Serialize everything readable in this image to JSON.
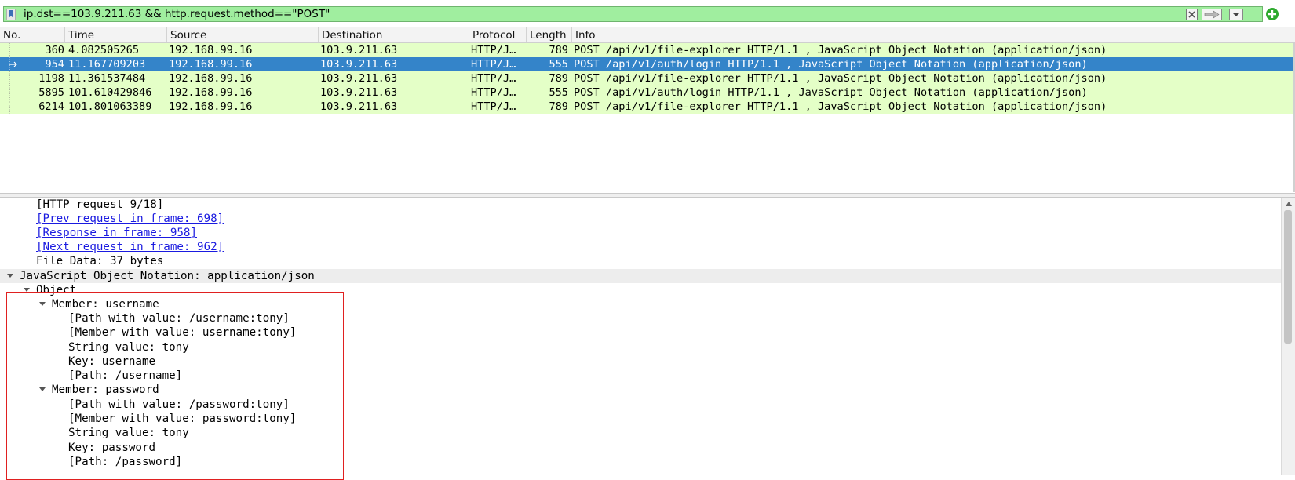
{
  "filter": {
    "expression": "ip.dst==103.9.211.63 && http.request.method==\"POST\"",
    "icons": [
      "bookmark-icon",
      "clear-icon",
      "apply-arrow-icon",
      "dropdown-icon",
      "add-icon"
    ],
    "bar_color": "#a0ee9f"
  },
  "columns": {
    "no": "No.",
    "time": "Time",
    "source": "Source",
    "destination": "Destination",
    "protocol": "Protocol",
    "length": "Length",
    "info": "Info"
  },
  "packets": [
    {
      "no": "360",
      "time": "4.082505265",
      "source": "192.168.99.16",
      "destination": "103.9.211.63",
      "protocol": "HTTP/J…",
      "length": "789",
      "info": "POST /api/v1/file-explorer HTTP/1.1 , JavaScript Object Notation (application/json)"
    },
    {
      "no": "954",
      "time": "11.167709203",
      "source": "192.168.99.16",
      "destination": "103.9.211.63",
      "protocol": "HTTP/J…",
      "length": "555",
      "info": "POST /api/v1/auth/login HTTP/1.1 , JavaScript Object Notation (application/json)"
    },
    {
      "no": "1198",
      "time": "11.361537484",
      "source": "192.168.99.16",
      "destination": "103.9.211.63",
      "protocol": "HTTP/J…",
      "length": "789",
      "info": "POST /api/v1/file-explorer HTTP/1.1 , JavaScript Object Notation (application/json)"
    },
    {
      "no": "5895",
      "time": "101.610429846",
      "source": "192.168.99.16",
      "destination": "103.9.211.63",
      "protocol": "HTTP/J…",
      "length": "555",
      "info": "POST /api/v1/auth/login HTTP/1.1 , JavaScript Object Notation (application/json)"
    },
    {
      "no": "6214",
      "time": "101.801063389",
      "source": "192.168.99.16",
      "destination": "103.9.211.63",
      "protocol": "HTTP/J…",
      "length": "789",
      "info": "POST /api/v1/file-explorer HTTP/1.1 , JavaScript Object Notation (application/json)"
    }
  ],
  "selected_row_index": 1,
  "colors": {
    "row_bg": "#e4ffc7",
    "selected_bg": "#3484c9",
    "link": "#1a1ae0",
    "highlight_box": "#e02020"
  },
  "details": [
    {
      "text": "[HTTP request 9/18]",
      "link": false,
      "expander": "none"
    },
    {
      "text": "[Prev request in frame: 698]",
      "link": true,
      "expander": "none"
    },
    {
      "text": "[Response in frame: 958]",
      "link": true,
      "expander": "none"
    },
    {
      "text": "[Next request in frame: 962]",
      "link": true,
      "expander": "none"
    },
    {
      "text": "File Data: 37 bytes",
      "link": false,
      "expander": "none"
    },
    {
      "text": "JavaScript Object Notation: application/json",
      "link": false,
      "expander": "expanded",
      "highlighted": true
    },
    {
      "text": "Object",
      "link": false,
      "expander": "expanded"
    },
    {
      "text": "Member: username",
      "link": false,
      "expander": "expanded"
    },
    {
      "text": "[Path with value: /username:tony]",
      "link": false,
      "expander": "none"
    },
    {
      "text": "[Member with value: username:tony]",
      "link": false,
      "expander": "none"
    },
    {
      "text": "String value: tony",
      "link": false,
      "expander": "none"
    },
    {
      "text": "Key: username",
      "link": false,
      "expander": "none"
    },
    {
      "text": "[Path: /username]",
      "link": false,
      "expander": "none"
    },
    {
      "text": "Member: password",
      "link": false,
      "expander": "expanded"
    },
    {
      "text": "[Path with value: /password:tony]",
      "link": false,
      "expander": "none"
    },
    {
      "text": "[Member with value: password:tony]",
      "link": false,
      "expander": "none"
    },
    {
      "text": "String value: tony",
      "link": false,
      "expander": "none"
    },
    {
      "text": "Key: password",
      "link": false,
      "expander": "none"
    },
    {
      "text": "[Path: /password]",
      "link": false,
      "expander": "none"
    }
  ]
}
